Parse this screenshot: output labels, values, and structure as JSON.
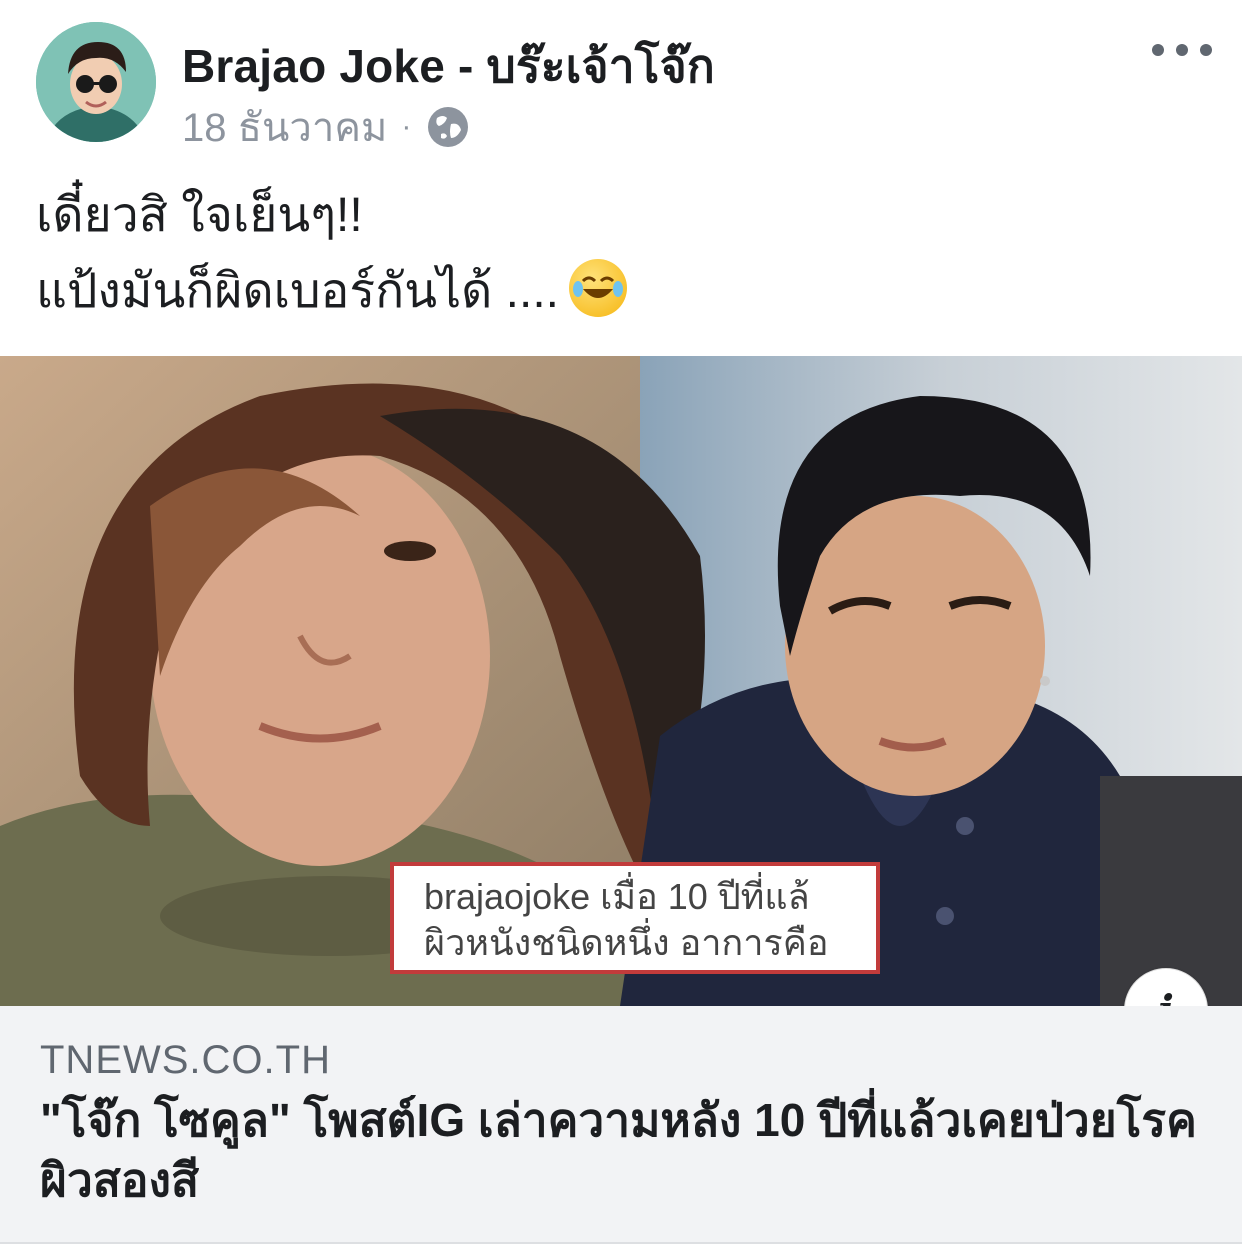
{
  "post": {
    "author": "Brajao Joke - บร๊ะเจ้าโจ๊ก",
    "date": "18 ธันวาคม",
    "separator": "·",
    "privacy_icon": "globe-icon",
    "more_icon": "more-options-icon",
    "caption_line1": "เดี๋ยวสิ ใจเย็นๆ!!",
    "caption_line2": "แป้งมันก็ผิดเบอร์กันได้ ....",
    "caption_emoji": "rolling-on-floor-laughing"
  },
  "image": {
    "overlay_line1": "brajaojoke เมื่อ 10 ปีที่แล้",
    "overlay_line2": "ผิวหนังชนิดหนึ่ง อาการคือ",
    "info_label": "i",
    "overlay_border_color": "#c23b3b"
  },
  "link": {
    "domain": "TNEWS.CO.TH",
    "title": "\"โจ๊ก โซคูล\" โพสต์IG เล่าความหลัง 10 ปีที่แล้วเคยป่วยโรคผิวสองสี"
  },
  "colors": {
    "text": "#1c1e21",
    "secondary": "#8d949e",
    "card_bg": "#f2f3f5"
  }
}
